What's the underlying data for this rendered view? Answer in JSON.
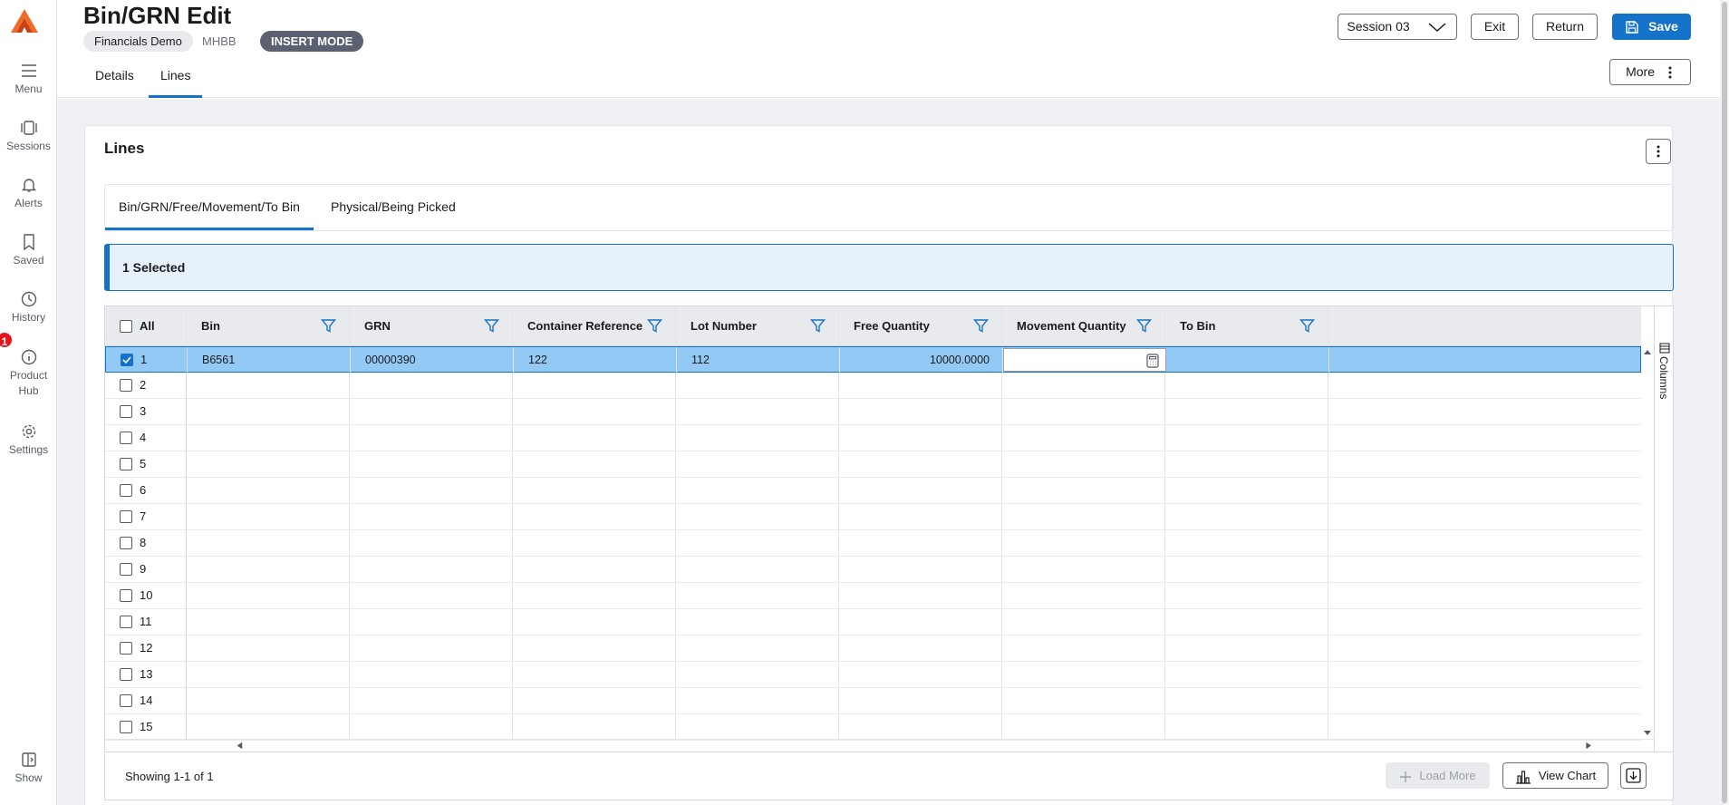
{
  "app": {
    "title": "Bin/GRN Edit",
    "company": "Financials Demo",
    "company_code": "MHBB",
    "mode": "INSERT MODE",
    "accent_color": "#1473c9"
  },
  "sidebar": {
    "items": [
      {
        "label": "Menu",
        "icon": "hamburger-icon"
      },
      {
        "label": "Sessions",
        "icon": "sessions-icon"
      },
      {
        "label": "Alerts",
        "icon": "bell-icon"
      },
      {
        "label": "Saved",
        "icon": "bookmark-icon"
      },
      {
        "label": "History",
        "icon": "clock-icon"
      },
      {
        "label": "Product Hub",
        "icon": "info-icon"
      },
      {
        "label": "Settings",
        "icon": "gear-icon"
      }
    ],
    "show_label": "Show",
    "notification_count": "1"
  },
  "header": {
    "tabs": [
      {
        "label": "Details"
      },
      {
        "label": "Lines"
      }
    ],
    "session_label": "Session 03",
    "exit_label": "Exit",
    "return_label": "Return",
    "save_label": "Save",
    "more_label": "More"
  },
  "panel": {
    "title": "Lines",
    "subtabs": [
      {
        "label": "Bin/GRN/Free/Movement/To Bin"
      },
      {
        "label": "Physical/Being Picked"
      }
    ],
    "selected_text": "1 Selected"
  },
  "grid": {
    "all_label": "All",
    "columns": [
      "Bin",
      "GRN",
      "Container Reference",
      "Lot Number",
      "Free Quantity",
      "Movement Quantity",
      "To Bin"
    ],
    "row_numbers": [
      "1",
      "2",
      "3",
      "4",
      "5",
      "6",
      "7",
      "8",
      "9",
      "10",
      "11",
      "12",
      "13",
      "14",
      "15"
    ],
    "rows": [
      {
        "bin": "B6561",
        "grn": "00000390",
        "container_reference": "122",
        "lot_number": "112",
        "free_quantity": "10000.0000",
        "movement_quantity": "",
        "to_bin": ""
      }
    ],
    "columns_label": "Columns"
  },
  "footer": {
    "showing": "Showing 1-1 of 1",
    "load_more_label": "Load More",
    "view_chart_label": "View Chart"
  }
}
